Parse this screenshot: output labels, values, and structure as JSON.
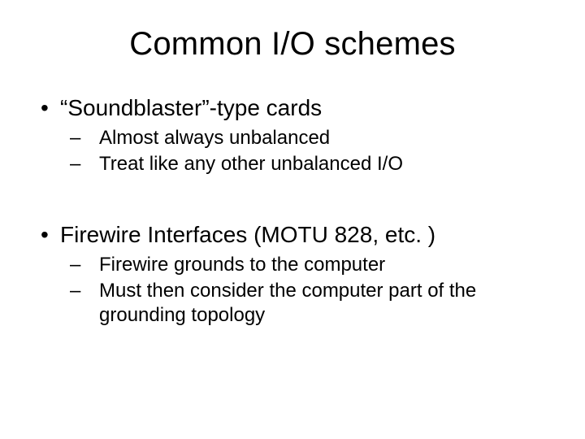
{
  "title": "Common I/O schemes",
  "bullets": [
    {
      "text": "“Soundblaster”-type cards",
      "sub": [
        "Almost always unbalanced",
        "Treat like any other unbalanced I/O"
      ]
    },
    {
      "text": "Firewire Interfaces (MOTU 828, etc. )",
      "sub": [
        "Firewire grounds to the computer",
        "Must then consider the computer part of the grounding topology"
      ]
    }
  ]
}
